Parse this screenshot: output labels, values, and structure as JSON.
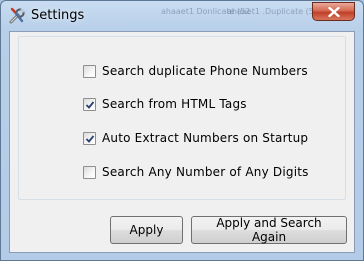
{
  "window": {
    "title": "Settings",
    "close_icon": "close-icon",
    "app_icon": "tools-icon",
    "ghost_text_left": "ahaaet1 Donlicate (52",
    "ghost_text_right": "ahaaet1 .Duplicate (51"
  },
  "options": [
    {
      "label": "Search duplicate Phone Numbers",
      "checked": false
    },
    {
      "label": "Search from HTML Tags",
      "checked": true
    },
    {
      "label": "Auto Extract Numbers on Startup",
      "checked": true
    },
    {
      "label": "Search Any Number of Any Digits",
      "checked": false
    }
  ],
  "buttons": {
    "apply_label": "Apply",
    "apply_search_label": "Apply and Search Again"
  }
}
